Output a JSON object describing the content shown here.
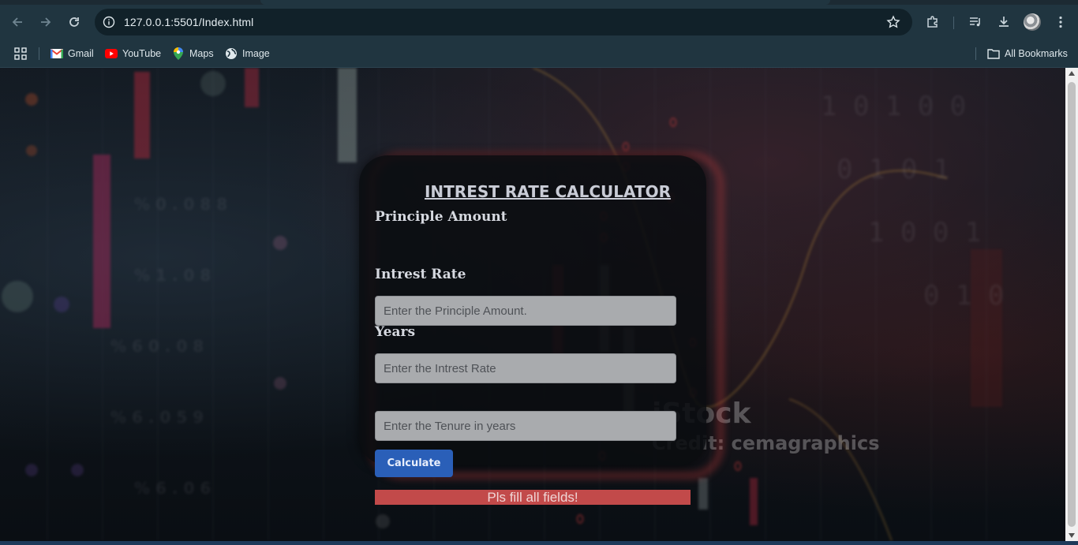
{
  "browser": {
    "url": "127.0.0.1:5501/Index.html",
    "icons": {
      "back": "back-arrow-icon",
      "forward": "forward-arrow-icon",
      "reload": "reload-icon",
      "site_info": "site-info-icon",
      "bookmark_star": "star-icon",
      "extensions": "puzzle-icon",
      "media": "media-playlist-icon",
      "downloads": "download-icon",
      "menu": "kebab-menu-icon"
    },
    "bookmarks": [
      {
        "label": "Gmail",
        "icon": "gmail-icon"
      },
      {
        "label": "YouTube",
        "icon": "youtube-icon"
      },
      {
        "label": "Maps",
        "icon": "maps-icon"
      },
      {
        "label": "Image",
        "icon": "globe-icon"
      }
    ],
    "all_bookmarks_label": "All Bookmarks"
  },
  "watermark": {
    "brand": "iStock",
    "credit": "Credit: cemagraphics"
  },
  "calculator": {
    "title": "INTREST RATE CALCULATOR",
    "principal_label": "Principle Amount",
    "principal_placeholder": "Enter the Principle Amount.",
    "rate_label": "Intrest Rate",
    "rate_placeholder": "Enter the Intrest Rate",
    "years_label": "Years",
    "years_placeholder": "Enter the Tenure in years",
    "button_label": "Calculate",
    "error_message": "Pls fill all fields!"
  },
  "colors": {
    "chrome_bg": "#203540",
    "button_blue": "#2a5fb8",
    "error_red": "#c24a4a",
    "card_glow": "#c83c3c"
  }
}
